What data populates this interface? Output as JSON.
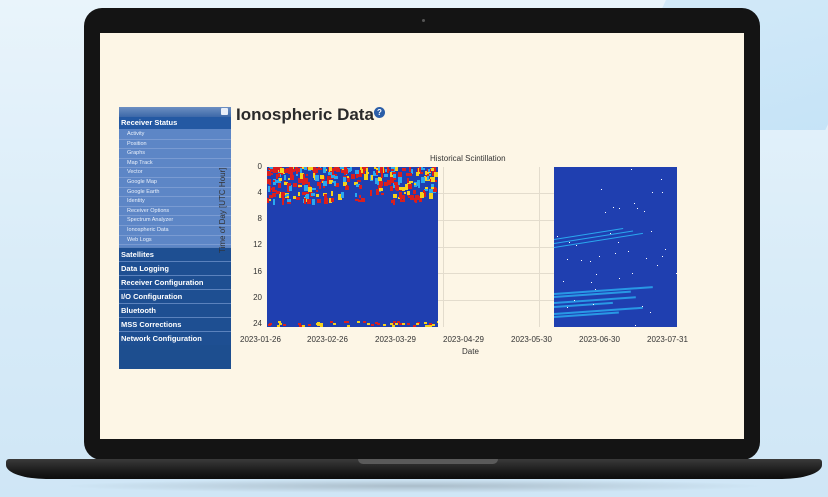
{
  "sidebar": {
    "section_header": "Receiver Status",
    "sub_items": [
      "Activity",
      "Position",
      "Graphs",
      "Map Track",
      "Vector",
      "Google Map",
      "Google Earth",
      "Identity",
      "Receiver Options",
      "Spectrum Analyzer",
      "Ionospheric Data",
      "Web Logs"
    ],
    "items": [
      "Satellites",
      "Data Logging",
      "Receiver Configuration",
      "I/O Configuration",
      "Bluetooth",
      "MSS Corrections",
      "Network Configuration"
    ]
  },
  "page": {
    "title": "Ionospheric Data"
  },
  "chart_data": {
    "type": "heatmap",
    "title": "Historical Scintillation",
    "xlabel": "Date",
    "ylabel": "Time of Day [UTC Hour]",
    "x_ticks": [
      "2023-01-26",
      "2023-02-26",
      "2023-03-29",
      "2023-04-29",
      "2023-05-30",
      "2023-06-30",
      "2023-07-31"
    ],
    "y_ticks": [
      "0",
      "4",
      "8",
      "12",
      "16",
      "20",
      "24"
    ],
    "ylim": [
      24,
      0
    ],
    "panels": [
      {
        "start": "2023-01-26",
        "end": "2023-04-25"
      },
      {
        "start": "2023-06-09",
        "end": "2023-07-26"
      }
    ],
    "colors": {
      "background": "#1f3fb0",
      "high": "#d91f1f",
      "mid": "#f5d21c",
      "low": "#2aa8ef"
    }
  }
}
